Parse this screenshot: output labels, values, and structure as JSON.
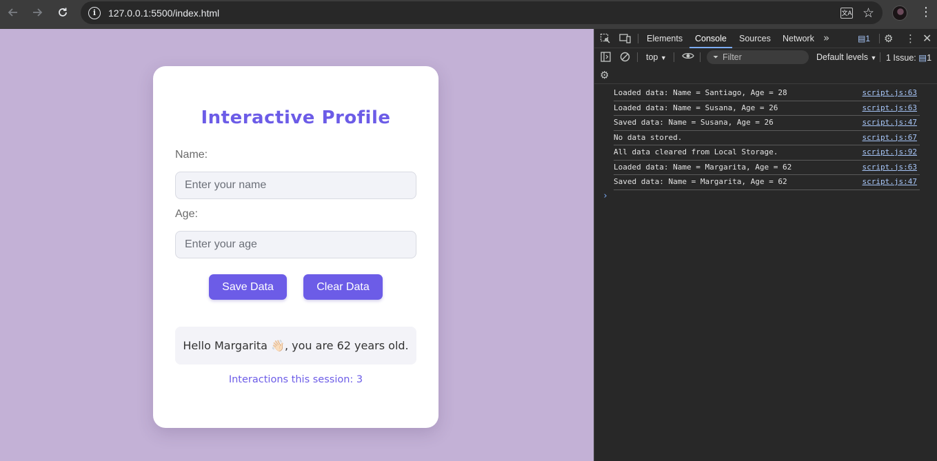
{
  "browser": {
    "url": "127.0.0.1:5500/index.html",
    "icons": {
      "back": "arrow-left-icon",
      "forward": "arrow-right-icon",
      "reload": "reload-icon",
      "site_info": "info-icon",
      "translate": "translate-icon",
      "bookmark": "star-icon",
      "menu": "kebab-menu-icon"
    }
  },
  "page": {
    "title": "Interactive Profile",
    "name_label": "Name:",
    "name_placeholder": "Enter your name",
    "name_value": "",
    "age_label": "Age:",
    "age_placeholder": "Enter your age",
    "age_value": "",
    "save_button": "Save Data",
    "clear_button": "Clear Data",
    "greeting": "Hello Margarita 👋🏻, you are 62 years old.",
    "counter": "Interactions this session: 3",
    "colors": {
      "accent": "#6c5ce7",
      "background": "#c3b1d6",
      "card": "#ffffff"
    }
  },
  "devtools": {
    "tabs": [
      "Elements",
      "Console",
      "Sources",
      "Network"
    ],
    "active_tab": "Console",
    "message_badge": "1",
    "context": "top",
    "filter_placeholder": "Filter",
    "levels": "Default levels",
    "issues_label": "1 Issue:",
    "issues_count": "1",
    "logs": [
      {
        "message": "Loaded data: Name = Santiago, Age = 28",
        "source": "script.js:63"
      },
      {
        "message": "Loaded data: Name = Susana, Age = 26",
        "source": "script.js:63"
      },
      {
        "message": "Saved data: Name = Susana, Age = 26",
        "source": "script.js:47"
      },
      {
        "message": "No data stored.",
        "source": "script.js:67"
      },
      {
        "message": "All data cleared from Local Storage.",
        "source": "script.js:92"
      },
      {
        "message": "Loaded data: Name = Margarita, Age = 62",
        "source": "script.js:63"
      },
      {
        "message": "Saved data: Name = Margarita, Age = 62",
        "source": "script.js:47"
      }
    ],
    "prompt": "›"
  }
}
